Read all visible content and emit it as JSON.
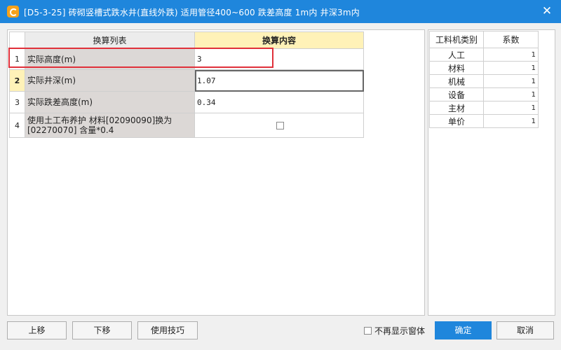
{
  "window": {
    "title": "[D5-3-25] 砖砌竖槽式跌水井(直线外跌) 适用管径400~600 跌差高度 1m内 井深3m内",
    "close_symbol": "✕"
  },
  "calc_table": {
    "headers": [
      "换算列表",
      "换算内容"
    ],
    "rows": [
      {
        "num": "1",
        "name": "实际高度(m)",
        "value": "3"
      },
      {
        "num": "2",
        "name": "实际井深(m)",
        "value": "1.07"
      },
      {
        "num": "3",
        "name": "实际跌差高度(m)",
        "value": "0.34"
      },
      {
        "num": "4",
        "name": "使用土工布养护 材料[02090090]换为[02270070] 含量*0.4",
        "value": ""
      }
    ]
  },
  "coef_table": {
    "headers": [
      "工料机类别",
      "系数"
    ],
    "rows": [
      {
        "category": "人工",
        "coef": "1"
      },
      {
        "category": "材料",
        "coef": "1"
      },
      {
        "category": "机械",
        "coef": "1"
      },
      {
        "category": "设备",
        "coef": "1"
      },
      {
        "category": "主材",
        "coef": "1"
      },
      {
        "category": "单价",
        "coef": "1"
      }
    ]
  },
  "buttons": {
    "move_up": "上移",
    "move_down": "下移",
    "tips": "使用技巧",
    "dont_show": "不再显示窗体",
    "ok": "确定",
    "cancel": "取消"
  },
  "colors": {
    "titlebar": "#1f86dc",
    "highlight_header": "#fff2b8",
    "name_cell_bg": "#dcd8d6",
    "annotation_box": "#e0303a"
  }
}
